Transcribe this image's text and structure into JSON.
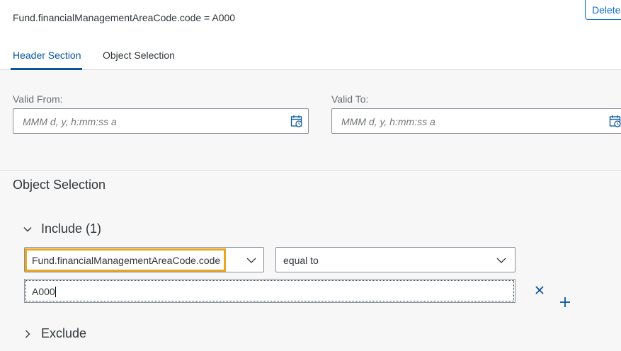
{
  "header": {
    "title": "Fund.financialManagementAreaCode.code = A000",
    "delete_label": "Delete"
  },
  "tabs": [
    {
      "label": "Header Section",
      "active": true
    },
    {
      "label": "Object Selection",
      "active": false
    }
  ],
  "header_section": {
    "valid_from": {
      "label": "Valid From:",
      "placeholder": "MMM d, y, h:mm:ss a"
    },
    "valid_to": {
      "label": "Valid To:",
      "placeholder": "MMM d, y, h:mm:ss a"
    },
    "calendar_icon": "calendar-icon"
  },
  "object_selection": {
    "title": "Object Selection",
    "include": {
      "label": "Include (1)",
      "expanded": true,
      "field_select": "Fund.financialManagementAreaCode.code",
      "operator_select": "equal to",
      "value": "A000"
    },
    "exclude": {
      "label": "Exclude",
      "expanded": false
    }
  },
  "colors": {
    "accent": "#0854a0",
    "highlight": "#e9a623",
    "section_bg": "#f7f7f7"
  }
}
